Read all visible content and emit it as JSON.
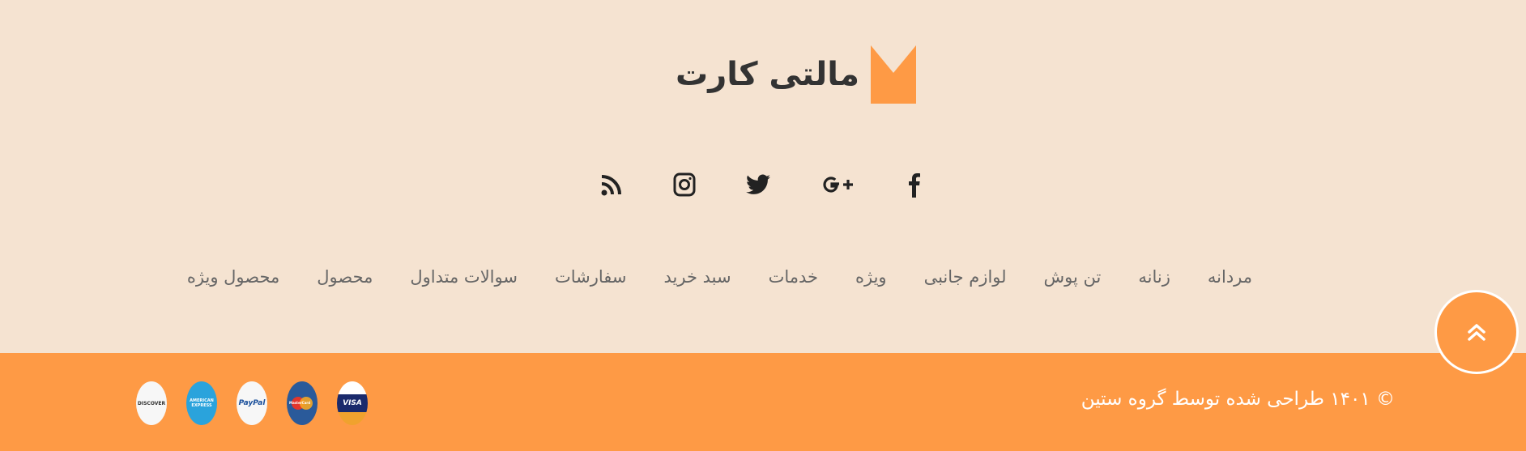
{
  "brand": {
    "name": "مالتی کارت",
    "accent_color": "#fe9a45",
    "background_color": "#f5e3d1",
    "text_color": "#333333"
  },
  "socials": [
    {
      "icon": "rss-icon"
    },
    {
      "icon": "instagram-icon"
    },
    {
      "icon": "twitter-icon"
    },
    {
      "icon": "google-plus-icon"
    },
    {
      "icon": "facebook-icon"
    }
  ],
  "nav": {
    "items": [
      {
        "label": "مردانه"
      },
      {
        "label": "زنانه"
      },
      {
        "label": "تن پوش"
      },
      {
        "label": "لوازم جانبی"
      },
      {
        "label": "ویژه"
      },
      {
        "label": "خدمات"
      },
      {
        "label": "سبد خرید"
      },
      {
        "label": "سفارشات"
      },
      {
        "label": "سوالات متداول"
      },
      {
        "label": "محصول"
      },
      {
        "label": "محصول ویژه"
      }
    ]
  },
  "back_to_top": {
    "icon": "double-chevron-up-icon"
  },
  "footer": {
    "copyright": "© ۱۴۰۱ طراحی شده توسط گروه ستین",
    "payments": [
      {
        "name": "DISCOVER",
        "icon": "discover-icon"
      },
      {
        "name": "AMERICAN EXPRESS",
        "icon": "amex-icon"
      },
      {
        "name": "PayPal",
        "icon": "paypal-icon"
      },
      {
        "name": "MasterCard",
        "icon": "mastercard-icon"
      },
      {
        "name": "VISA",
        "icon": "visa-icon"
      }
    ]
  }
}
